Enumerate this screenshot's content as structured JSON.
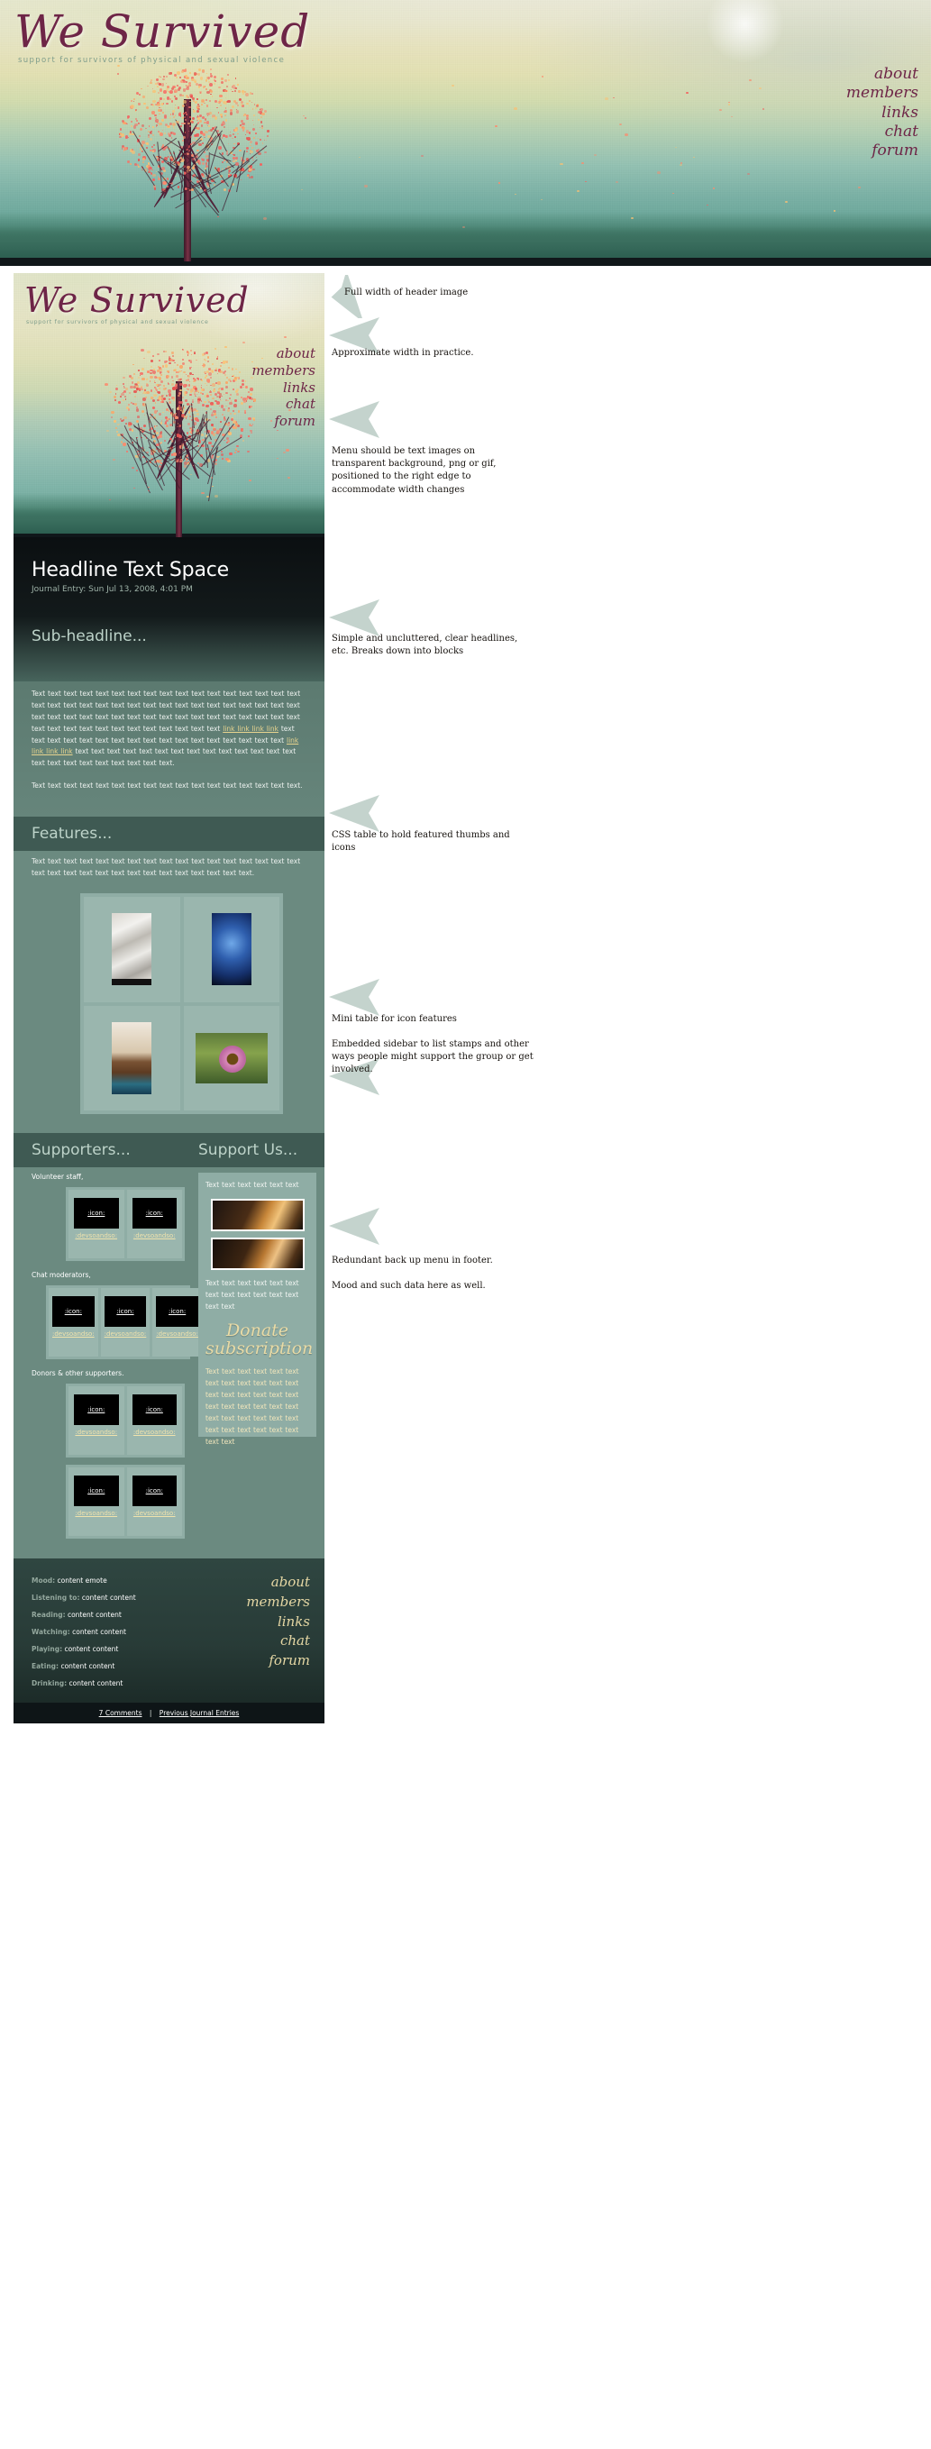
{
  "site": {
    "title": "We Survived",
    "tagline": "support for survivors of physical and sexual violence",
    "nav": [
      "about",
      "members",
      "links",
      "chat",
      "forum"
    ]
  },
  "journal": {
    "headline": "Headline Text Space",
    "meta": "Journal Entry: Sun Jul 13, 2008, 4:01 PM",
    "subheadline": "Sub-headline...",
    "paragraph_a_pre": "Text text text text text text text text text text text text text text text text text text text text text text text text text text text text text text text text text text text text text text text text text text text text text text text text text text text text text text text text text text text text text text text ",
    "link_1": "link link link link",
    "paragraph_a_mid": " text text text text text text text text text text text text text text text text text ",
    "link_2": "link link link link",
    "paragraph_a_post": " text text text text text text text text text text text text text text text text text text text text text text text.",
    "paragraph_b": "Text text text text text text text text text text text text text text text text text."
  },
  "features": {
    "heading": "Features...",
    "body": "Text text text text text text text text text text text text text text text text text text text text text text text text text text text text text text text."
  },
  "supporters": {
    "heading": "Supporters...",
    "group_1_label": "Volunteer staff,",
    "group_2_label": "Chat moderators,",
    "group_3_label": "Donors & other supporters.",
    "icon_text": ":icon:",
    "dev_text": ":devsoandso:",
    "group_1_count": 2,
    "group_2_count": 3,
    "group_3_count": 2,
    "group_4_count": 2
  },
  "support_us": {
    "heading": "Support Us...",
    "intro": "Text text text text text text",
    "mid": "Text text text text text text text text text text text text text text",
    "donate_line_1": "Donate",
    "donate_line_2": "subscription",
    "outro": "Text text text text text text text text text text text text text text text text text text text text text text text text text text text text text text text text text text text text text text"
  },
  "footer": {
    "rows": [
      {
        "label": "Mood:",
        "value": "content emote"
      },
      {
        "label": "Listening to:",
        "value": "content content"
      },
      {
        "label": "Reading:",
        "value": "content content"
      },
      {
        "label": "Watching:",
        "value": "content content"
      },
      {
        "label": "Playing:",
        "value": "content content"
      },
      {
        "label": "Eating:",
        "value": "content content"
      },
      {
        "label": "Drinking:",
        "value": "content content"
      }
    ],
    "nav": [
      "about",
      "members",
      "links",
      "chat",
      "forum"
    ],
    "comments": "7 Comments",
    "separator": "|",
    "previous": "Previous Journal Entries"
  },
  "annotations": [
    {
      "id": "a1",
      "text": "Full width of header image"
    },
    {
      "id": "a2",
      "text": "Approximate width in practice."
    },
    {
      "id": "a3",
      "text": "Menu should be text images on transparent background, png or gif, positioned to the right edge to accommodate width changes"
    },
    {
      "id": "a4",
      "text": "Simple and uncluttered, clear headlines, etc. Breaks down into blocks"
    },
    {
      "id": "a5",
      "text": "CSS table to hold featured thumbs and icons"
    },
    {
      "id": "a6",
      "text": "Mini table for icon features"
    },
    {
      "id": "a7",
      "text": "Embedded sidebar to list stamps and other ways  people might support the group or get involved."
    },
    {
      "id": "a8",
      "text": "Redundant back up menu in footer."
    },
    {
      "id": "a9",
      "text": "Mood and such data here as well."
    }
  ],
  "colors": {
    "wordmark": "#6e2547",
    "tagline": "#7f9d8b",
    "link": "#e7d48f",
    "arrow": "#c4d3cd",
    "band_dark": "#3f5a53",
    "band_mid": "#6b8a80",
    "journal_bg": "#0d1113"
  }
}
